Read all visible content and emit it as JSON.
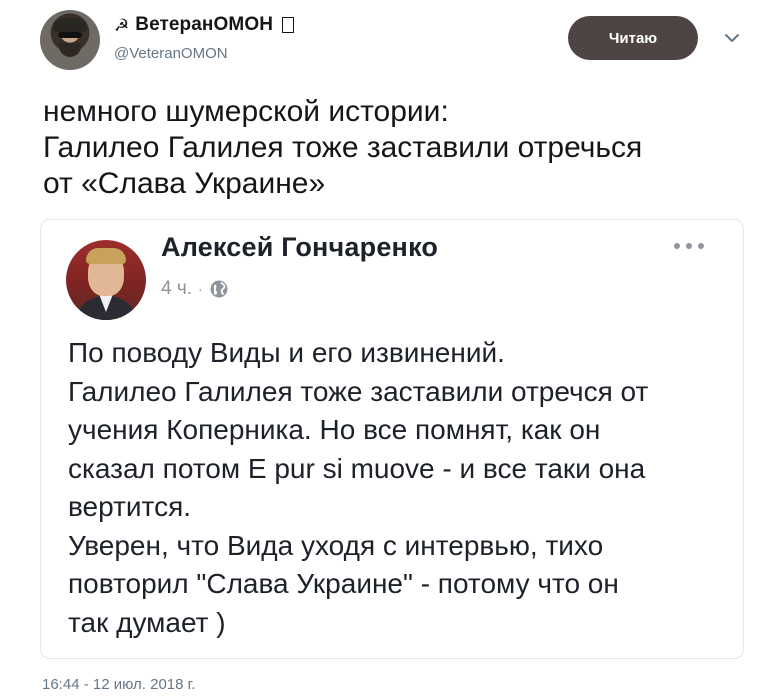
{
  "tweet": {
    "author": {
      "display_name": "ВетеранОМОН",
      "name_prefix_icon": "☭",
      "handle": "@VeteranOMON"
    },
    "follow_button_label": "Читаю",
    "text": "немного шумерской истории:\nГалилео Галилея тоже заставили отречься\nот «Слава Украине»",
    "timestamp": "16:44 - 12 июл. 2018 г."
  },
  "embedded_post": {
    "author_name": "Алексей Гончаренко",
    "time": "4 ч.",
    "dot": "·",
    "text": "По поводу Виды и его извинений.\nГалилео Галилея тоже заставили отречся от\nучения Коперника. Но все помнят, как он\nсказал потом E pur si muove - и все таки она\nвертится.\nУверен, что Вида уходя с интервью, тихо\nповторил \"Слава Украине\" - потому что он\nтак думает )"
  },
  "icons": {
    "caret": "chevron-down-icon",
    "more": "more-dots-icon",
    "globe": "globe-icon",
    "badge": "missing-glyph-box"
  },
  "colors": {
    "follow_button_bg": "#4e4444",
    "handle_gray": "#657786",
    "card_border": "#e1e8ed",
    "fb_meta_gray": "#90949c"
  }
}
